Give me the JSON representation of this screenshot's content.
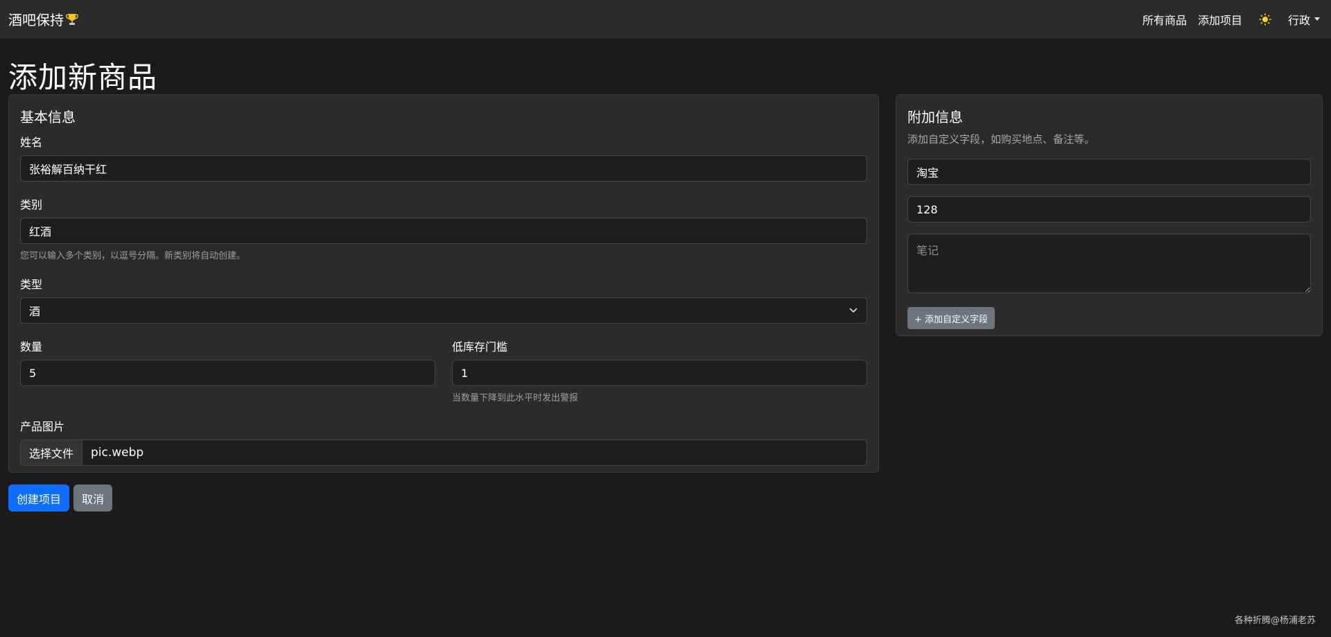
{
  "navbar": {
    "brand": "酒吧保持",
    "links": [
      "所有商品",
      "添加项目"
    ],
    "user": "行政"
  },
  "page": {
    "title": "添加新商品"
  },
  "basic": {
    "title": "基本信息",
    "name_label": "姓名",
    "name_value": "张裕解百纳干红",
    "category_label": "类别",
    "category_value": "红酒",
    "category_help": "您可以输入多个类别，以逗号分隔。新类别将自动创建。",
    "type_label": "类型",
    "type_value": "酒",
    "qty_label": "数量",
    "qty_value": "5",
    "low_label": "低库存门槛",
    "low_value": "1",
    "low_help": "当数量下降到此水平时发出警报",
    "image_label": "产品图片",
    "file_button": "选择文件",
    "file_name": "pic.webp"
  },
  "extra": {
    "title": "附加信息",
    "subtitle": "添加自定义字段，如购买地点、备注等。",
    "field1_value": "淘宝",
    "field2_value": "128",
    "notes_placeholder": "笔记",
    "add_field_button": "+ 添加自定义字段"
  },
  "actions": {
    "create": "创建项目",
    "cancel": "取消"
  },
  "footer": {
    "credit": "各种折腾@杨浦老苏"
  },
  "colors": {
    "primary": "#0d6efd",
    "secondary": "#6c757d",
    "background": "#1b1b1b",
    "card": "#2b2b2b"
  }
}
